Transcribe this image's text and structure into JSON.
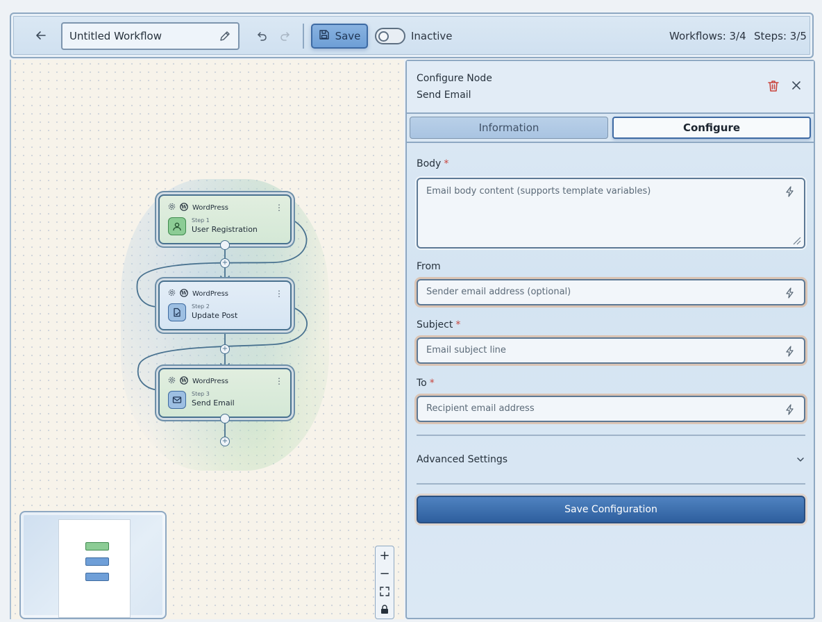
{
  "header": {
    "workflow_title": "Untitled Workflow",
    "save_label": "Save",
    "status_label": "Inactive",
    "workflows_counter": "Workflows: 3/4",
    "steps_counter": "Steps: 3/5"
  },
  "canvas": {
    "nodes": [
      {
        "provider": "WordPress",
        "step": "Step 1",
        "title": "User Registration",
        "icon": "user-icon",
        "color": "green"
      },
      {
        "provider": "WordPress",
        "step": "Step 2",
        "title": "Update Post",
        "icon": "document-icon",
        "color": "blue"
      },
      {
        "provider": "WordPress",
        "step": "Step 3",
        "title": "Send Email",
        "icon": "mail-icon",
        "color": "blue"
      }
    ],
    "zoom_controls": [
      "+",
      "−"
    ]
  },
  "panel": {
    "title": "Configure Node",
    "subtitle": "Send Email",
    "tabs": [
      "Information",
      "Configure"
    ],
    "active_tab": "Configure",
    "fields": {
      "body": {
        "label": "Body",
        "placeholder": "Email body content (supports template variables)",
        "required": "*"
      },
      "from": {
        "label": "From",
        "placeholder": "Sender email address (optional)"
      },
      "subject": {
        "label": "Subject",
        "placeholder": "Email subject line",
        "required": "*"
      },
      "to": {
        "label": "To",
        "placeholder": "Recipient email address",
        "required": "*"
      }
    },
    "advanced_label": "Advanced Settings",
    "save_config_label": "Save Configuration"
  },
  "colors": {
    "accent": "#3e6aa3",
    "required": "#c9453d",
    "trash": "#c9453d"
  }
}
